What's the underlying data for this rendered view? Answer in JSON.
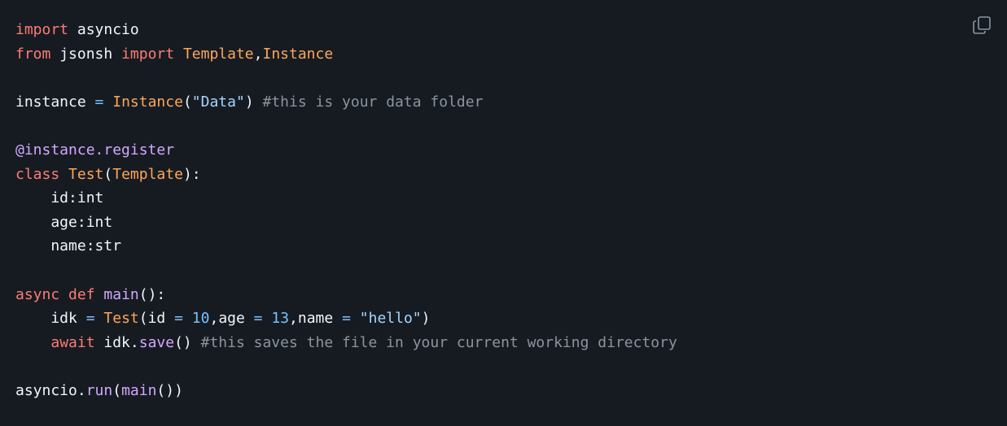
{
  "code": {
    "lines": [
      [
        {
          "t": "import",
          "c": "kw"
        },
        {
          "t": " asyncio",
          "c": ""
        }
      ],
      [
        {
          "t": "from",
          "c": "kw"
        },
        {
          "t": " jsonsh ",
          "c": ""
        },
        {
          "t": "import",
          "c": "kw"
        },
        {
          "t": " ",
          "c": ""
        },
        {
          "t": "Template",
          "c": "cls"
        },
        {
          "t": ",",
          "c": ""
        },
        {
          "t": "Instance",
          "c": "cls"
        }
      ],
      [],
      [
        {
          "t": "instance ",
          "c": ""
        },
        {
          "t": "=",
          "c": "op"
        },
        {
          "t": " ",
          "c": ""
        },
        {
          "t": "Instance",
          "c": "cls"
        },
        {
          "t": "(",
          "c": ""
        },
        {
          "t": "\"Data\"",
          "c": "str"
        },
        {
          "t": ") ",
          "c": ""
        },
        {
          "t": "#this is your data folder",
          "c": "cmt"
        }
      ],
      [],
      [
        {
          "t": "@instance.register",
          "c": "fn"
        }
      ],
      [
        {
          "t": "class",
          "c": "kw"
        },
        {
          "t": " ",
          "c": ""
        },
        {
          "t": "Test",
          "c": "cls"
        },
        {
          "t": "(",
          "c": ""
        },
        {
          "t": "Template",
          "c": "cls"
        },
        {
          "t": "):",
          "c": ""
        }
      ],
      [
        {
          "t": "    id:int",
          "c": ""
        }
      ],
      [
        {
          "t": "    age:int",
          "c": ""
        }
      ],
      [
        {
          "t": "    name:str",
          "c": ""
        }
      ],
      [],
      [
        {
          "t": "async",
          "c": "kw"
        },
        {
          "t": " ",
          "c": ""
        },
        {
          "t": "def",
          "c": "kw"
        },
        {
          "t": " ",
          "c": ""
        },
        {
          "t": "main",
          "c": "fn"
        },
        {
          "t": "():",
          "c": ""
        }
      ],
      [
        {
          "t": "    idk ",
          "c": ""
        },
        {
          "t": "=",
          "c": "op"
        },
        {
          "t": " ",
          "c": ""
        },
        {
          "t": "Test",
          "c": "cls"
        },
        {
          "t": "(id ",
          "c": ""
        },
        {
          "t": "=",
          "c": "op"
        },
        {
          "t": " ",
          "c": ""
        },
        {
          "t": "10",
          "c": "num"
        },
        {
          "t": ",age ",
          "c": ""
        },
        {
          "t": "=",
          "c": "op"
        },
        {
          "t": " ",
          "c": ""
        },
        {
          "t": "13",
          "c": "num"
        },
        {
          "t": ",name ",
          "c": ""
        },
        {
          "t": "=",
          "c": "op"
        },
        {
          "t": " ",
          "c": ""
        },
        {
          "t": "\"hello\"",
          "c": "str"
        },
        {
          "t": ")",
          "c": ""
        }
      ],
      [
        {
          "t": "    ",
          "c": ""
        },
        {
          "t": "await",
          "c": "kw"
        },
        {
          "t": " idk.",
          "c": ""
        },
        {
          "t": "save",
          "c": "fn"
        },
        {
          "t": "() ",
          "c": ""
        },
        {
          "t": "#this saves the file in your current working directory",
          "c": "cmt"
        }
      ],
      [],
      [
        {
          "t": "asyncio.",
          "c": ""
        },
        {
          "t": "run",
          "c": "fn"
        },
        {
          "t": "(",
          "c": ""
        },
        {
          "t": "main",
          "c": "fn"
        },
        {
          "t": "())",
          "c": ""
        }
      ]
    ]
  },
  "copy_button": {
    "icon": "copy-icon"
  }
}
